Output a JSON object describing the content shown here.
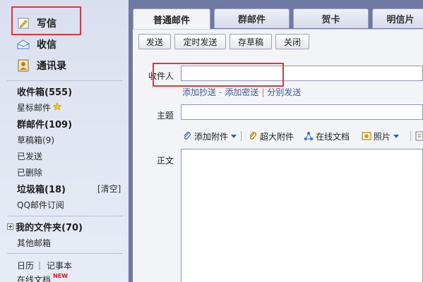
{
  "sidebar": {
    "top": {
      "compose": "写信",
      "inbox": "收信",
      "contacts": "通讯录"
    },
    "folders": {
      "inbox_count": "收件箱(555)",
      "starred": "星标邮件",
      "group_mail": "群邮件(109)",
      "drafts": "草稿箱(9)",
      "sent": "已发送",
      "deleted": "已删除",
      "spam": "垃圾箱(18)",
      "clear": "[清空]",
      "subscriptions": "QQ邮件订阅"
    },
    "my_folders": "我的文件夹(70)",
    "other_mailbox": "其他邮箱",
    "calendar": "日历",
    "notebook": "记事本",
    "online_docs": "在线文档",
    "new_badge": "NEW",
    "pipe": "|"
  },
  "tabs": [
    "普通邮件",
    "群邮件",
    "贺卡",
    "明信片"
  ],
  "toolbar": {
    "send": "发送",
    "scheduled": "定时发送",
    "save_draft": "存草稿",
    "close": "关闭"
  },
  "compose": {
    "to_label": "收件人",
    "cc": "添加抄送",
    "bcc": "添加密送",
    "separate": "分别发送",
    "dash": "-",
    "pipe": "|",
    "subject_label": "主题",
    "body_label": "正文"
  },
  "attach": {
    "add": "添加附件",
    "large": "超大附件",
    "online_doc": "在线文档",
    "photo": "照片"
  },
  "colors": {
    "highlight": "#e5343d",
    "link": "#3a5d9a",
    "panel": "#f3f4f7"
  }
}
